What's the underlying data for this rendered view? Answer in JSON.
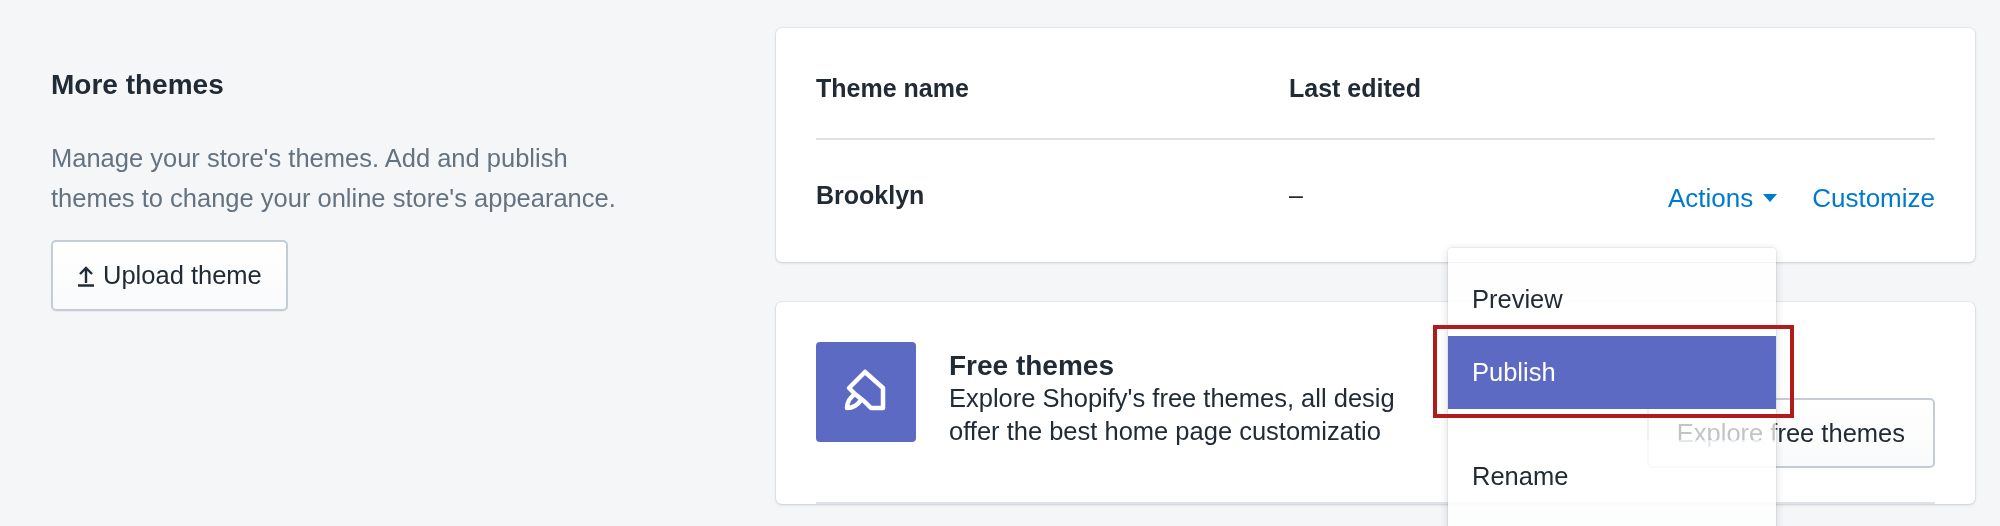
{
  "intro": {
    "title": "More themes",
    "description": "Manage your store's themes. Add and publish themes to change your online store's appearance.",
    "upload_button": "Upload theme"
  },
  "themes_table": {
    "columns": [
      "Theme name",
      "Last edited"
    ],
    "rows": [
      {
        "name": "Brooklyn",
        "last_edited": "–",
        "actions": "Actions",
        "customize": "Customize"
      }
    ]
  },
  "actions_menu": {
    "sections": [
      [
        {
          "label": "Preview",
          "selected": false
        },
        {
          "label": "Publish",
          "selected": true
        }
      ],
      [
        {
          "label": "Rename",
          "selected": false
        }
      ]
    ]
  },
  "free_themes": {
    "title": "Free themes",
    "description_lines": [
      "Explore Shopify's free themes, all desig",
      "offer the best home page customizatio"
    ],
    "button": "Explore free themes"
  }
}
